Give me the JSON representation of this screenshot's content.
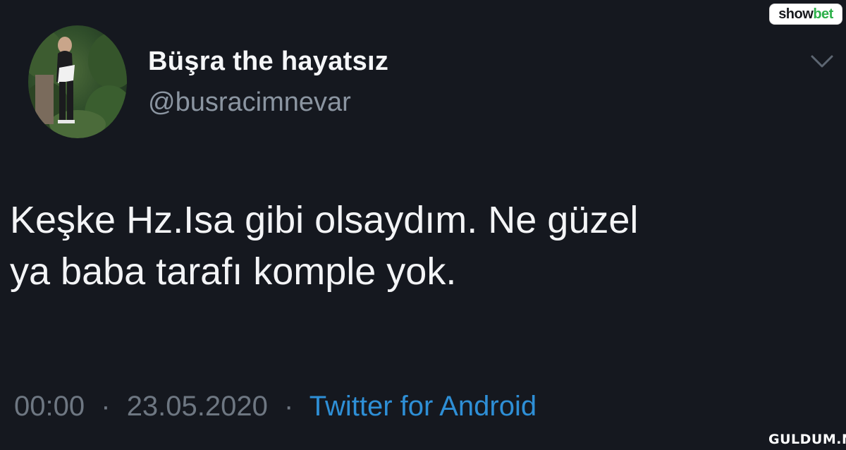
{
  "tweet": {
    "display_name": "Büşra the hayatsız",
    "handle": "@busracimnevar",
    "text_lines": [
      "Keşke Hz.Isa gibi olsaydım. Ne güzel",
      "ya baba tarafı komple yok."
    ],
    "time": "00:00",
    "date": "23.05.2020",
    "separator": "·",
    "source": "Twitter for Android",
    "menu_icon": "chevron-down-icon",
    "avatar_icon": "profile-photo"
  },
  "watermarks": {
    "top_part1": "show",
    "top_part2": "bet",
    "bottom": "GULDUM.NET"
  },
  "colors": {
    "background": "#15181f",
    "name": "#f5f6f8",
    "handle": "#8b95a1",
    "meta": "#6e7782",
    "link": "#2e8fd6",
    "brand_green": "#2db04a"
  }
}
